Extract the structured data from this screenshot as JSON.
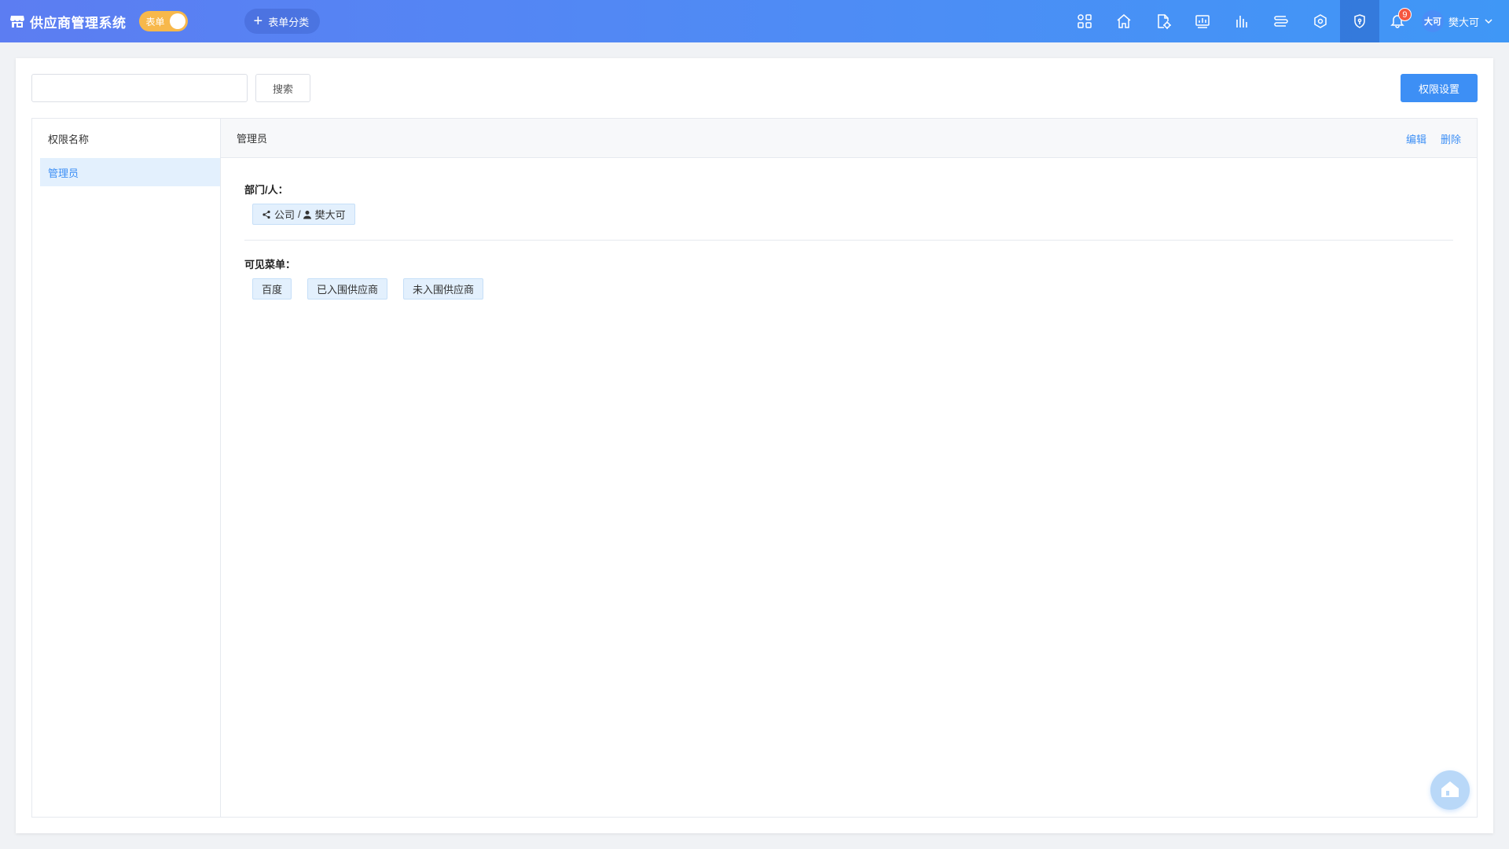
{
  "header": {
    "app_title": "供应商管理系统",
    "toggle_label": "表单",
    "add_category_label": "表单分类",
    "nav_icons": [
      "apps-icon",
      "home-icon",
      "document-settings-icon",
      "dashboard-icon",
      "bar-chart-icon",
      "list-icon",
      "hexagon-settings-icon",
      "shield-icon"
    ],
    "notification_count": "9",
    "avatar_text": "大可",
    "username": "樊大可"
  },
  "toolbar": {
    "search_placeholder": "",
    "search_label": "搜索",
    "permission_settings_label": "权限设置"
  },
  "left_panel": {
    "header": "权限名称",
    "items": [
      {
        "label": "管理员",
        "selected": true
      }
    ]
  },
  "detail": {
    "title": "管理员",
    "edit_label": "编辑",
    "delete_label": "删除",
    "dept_section_title": "部门/人：",
    "dept_tag": {
      "dept": "公司",
      "separator": "/",
      "person": "樊大可"
    },
    "menu_section_title": "可见菜单：",
    "menus": [
      "百度",
      "已入围供应商",
      "未入围供应商"
    ]
  },
  "colors": {
    "accent": "#3d8ff5",
    "header_gradient_start": "#5c7df2",
    "toggle": "#f7b84b",
    "badge": "#f5563e",
    "tag_bg": "#e3f0fd"
  }
}
